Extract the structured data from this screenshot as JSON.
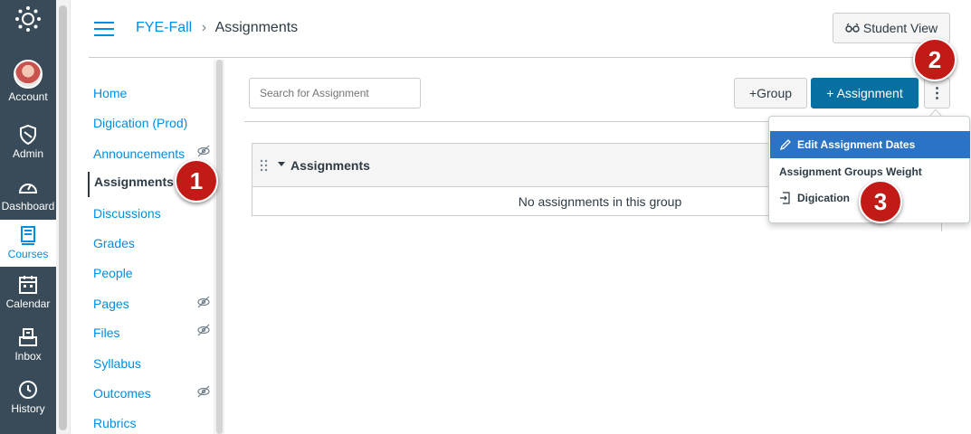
{
  "global_nav": {
    "items": [
      {
        "label": "Account",
        "icon": "account-avatar"
      },
      {
        "label": "Admin",
        "icon": "shield-icon"
      },
      {
        "label": "Dashboard",
        "icon": "dashboard-gauge-icon"
      },
      {
        "label": "Courses",
        "icon": "book-icon",
        "active": true
      },
      {
        "label": "Calendar",
        "icon": "calendar-icon"
      },
      {
        "label": "Inbox",
        "icon": "inbox-icon"
      },
      {
        "label": "History",
        "icon": "clock-icon"
      }
    ]
  },
  "header": {
    "breadcrumb": {
      "course": "FYE-Fall",
      "separator": "›",
      "page": "Assignments"
    },
    "student_view_label": "Student View"
  },
  "course_nav": {
    "items": [
      {
        "label": "Home"
      },
      {
        "label": "Digication (Prod)"
      },
      {
        "label": "Announcements",
        "hidden_icon": true
      },
      {
        "label": "Assignments",
        "active": true
      },
      {
        "label": "Discussions"
      },
      {
        "label": "Grades"
      },
      {
        "label": "People"
      },
      {
        "label": "Pages",
        "hidden_icon": true
      },
      {
        "label": "Files",
        "hidden_icon": true
      },
      {
        "label": "Syllabus"
      },
      {
        "label": "Outcomes",
        "hidden_icon": true
      },
      {
        "label": "Rubrics"
      }
    ]
  },
  "toolbar": {
    "search_placeholder": "Search for Assignment",
    "group_button": "+Group",
    "assignment_button": "+ Assignment",
    "kebab_label": "⋮"
  },
  "assignment_group": {
    "title": "Assignments",
    "empty_text": "No assignments in this group"
  },
  "dropdown_menu": {
    "items": [
      {
        "label": "Edit Assignment Dates",
        "icon": "pencil-icon",
        "highlighted": true
      },
      {
        "label": "Assignment Groups Weight"
      },
      {
        "label": "Digication",
        "icon": "external-tool-icon"
      }
    ]
  },
  "step_badges": [
    "1",
    "2",
    "3"
  ],
  "colors": {
    "global_nav_bg": "#394b58",
    "link": "#008ee2",
    "primary_button": "#0770a3",
    "menu_highlight": "#2b73c4",
    "badge": "#c21b17"
  }
}
